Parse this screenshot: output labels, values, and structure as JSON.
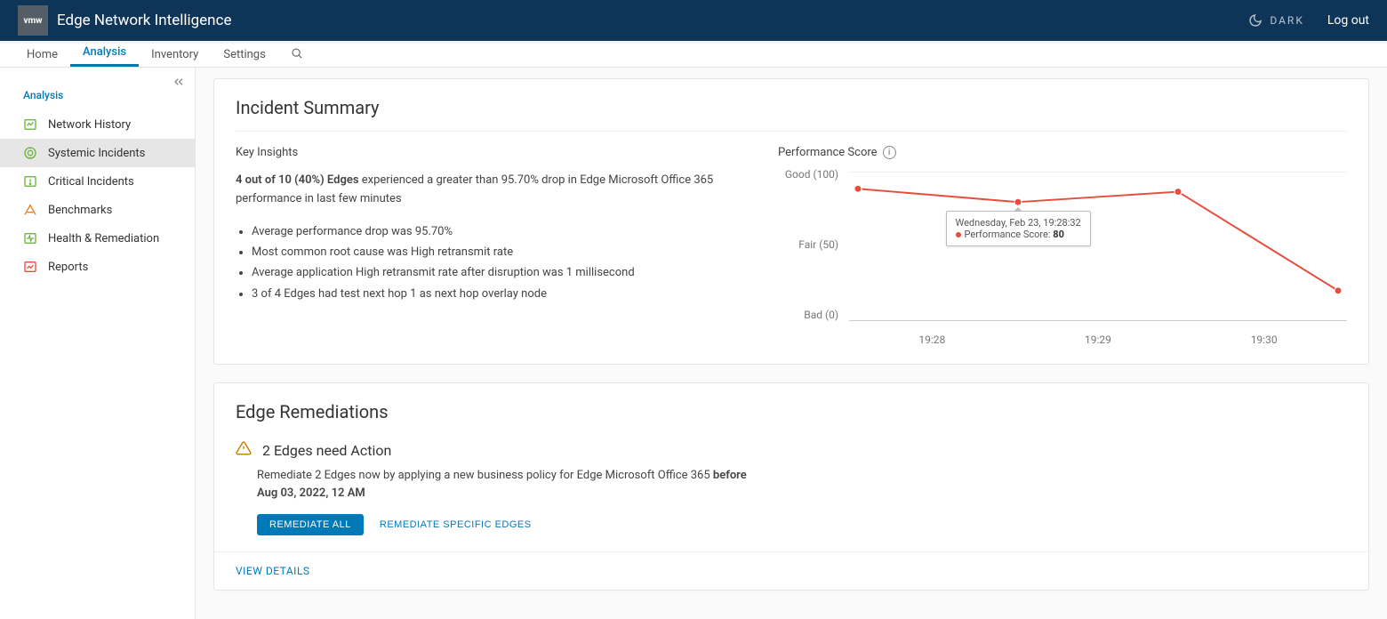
{
  "header": {
    "logo_text": "vmw",
    "app_title": "Edge Network Intelligence",
    "dark_label": "DARK",
    "logout": "Log out"
  },
  "nav": {
    "tabs": [
      "Home",
      "Analysis",
      "Inventory",
      "Settings"
    ],
    "active_tab": "Analysis"
  },
  "sidebar": {
    "section_title": "Analysis",
    "items": [
      {
        "label": "Network History"
      },
      {
        "label": "Systemic Incidents"
      },
      {
        "label": "Critical Incidents"
      },
      {
        "label": "Benchmarks"
      },
      {
        "label": "Health & Remediation"
      },
      {
        "label": "Reports"
      }
    ],
    "selected": "Systemic Incidents"
  },
  "incident": {
    "title": "Incident Summary",
    "key_insights_label": "Key Insights",
    "lead_bold": "4 out of 10 (40%) Edges",
    "lead_rest": " experienced a greater than 95.70% drop in Edge Microsoft Office 365 performance in last few minutes",
    "bullets": [
      "Average performance drop was 95.70%",
      "Most common root cause was High retransmit rate",
      "Average application High retransmit rate after disruption was 1 millisecond",
      "3 of 4 Edges had test next hop 1 as next hop overlay node"
    ],
    "score_label": "Performance Score",
    "tooltip_date": "Wednesday, Feb 23, 19:28:32",
    "tooltip_metric": "Performance Score: ",
    "tooltip_value": "80"
  },
  "chart_data": {
    "type": "line",
    "xlabel": "",
    "ylabel": "",
    "ylim": [
      0,
      100
    ],
    "y_ticks": [
      {
        "label": "Good (100)",
        "value": 100
      },
      {
        "label": "Fair (50)",
        "value": 50
      },
      {
        "label": "Bad (0)",
        "value": 0
      }
    ],
    "x_ticks": [
      "19:28",
      "19:29",
      "19:30"
    ],
    "x": [
      "19:28:00",
      "19:28:32",
      "19:29:20",
      "19:30:00"
    ],
    "values": [
      89,
      80,
      87,
      20
    ],
    "highlight_index": 1,
    "color": "#e74c3c"
  },
  "remediation": {
    "title": "Edge Remediations",
    "action_title": "2 Edges need Action",
    "text_a": "Remediate 2 Edges now by applying a new business policy for Edge Microsoft Office 365 ",
    "text_bold1": "before",
    "text_bold2": "Aug 03, 2022, 12 AM",
    "btn_primary": "REMEDIATE ALL",
    "btn_secondary": "REMEDIATE SPECIFIC EDGES",
    "view_details": "VIEW DETAILS"
  }
}
